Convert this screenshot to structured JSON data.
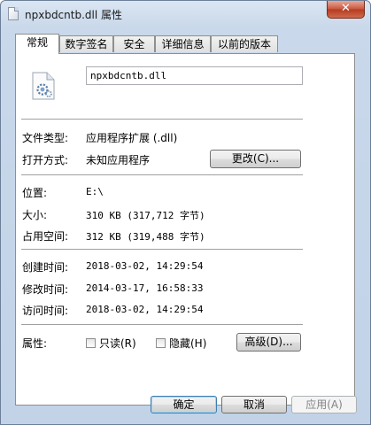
{
  "window": {
    "title": "npxbdcntb.dll 属性",
    "close_glyph": "✕"
  },
  "tabs": [
    {
      "label": "常规",
      "active": true
    },
    {
      "label": "数字签名",
      "active": false
    },
    {
      "label": "安全",
      "active": false
    },
    {
      "label": "详细信息",
      "active": false
    },
    {
      "label": "以前的版本",
      "active": false
    }
  ],
  "general": {
    "file_name": "npxbdcntb.dll",
    "file_type_label": "文件类型:",
    "file_type_value": "应用程序扩展 (.dll)",
    "opens_with_label": "打开方式:",
    "opens_with_value": "未知应用程序",
    "change_button": "更改(C)...",
    "location_label": "位置:",
    "location_value": "E:\\",
    "size_label": "大小:",
    "size_value": "310 KB (317,712 字节)",
    "size_on_disk_label": "占用空间:",
    "size_on_disk_value": "312 KB (319,488 字节)",
    "created_label": "创建时间:",
    "created_value": "2018-03-02, 14:29:54",
    "modified_label": "修改时间:",
    "modified_value": "2014-03-17, 16:58:33",
    "accessed_label": "访问时间:",
    "accessed_value": "2018-03-02, 14:29:54",
    "attributes_label": "属性:",
    "readonly_label": "只读(R)",
    "hidden_label": "隐藏(H)",
    "advanced_button": "高级(D)..."
  },
  "footer": {
    "ok_button": "确定",
    "cancel_button": "取消",
    "apply_button": "应用(A)"
  },
  "colors": {
    "frame": "#c9d8ea",
    "close_button": "#c8563c",
    "default_button_border": "#3c7fb1"
  }
}
